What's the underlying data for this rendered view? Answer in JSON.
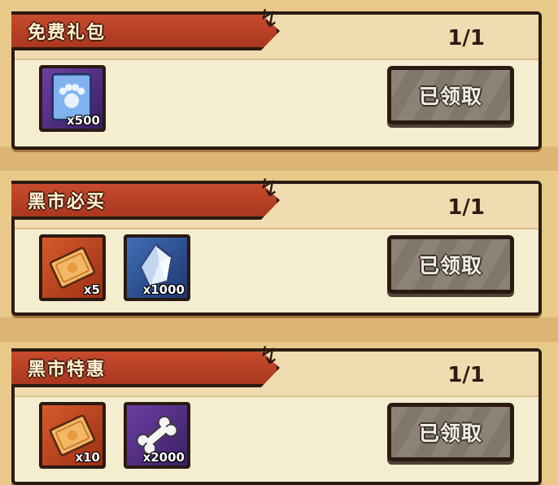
{
  "packs": [
    {
      "title": "免费礼包",
      "count": "1/1",
      "button_label": "已领取",
      "items": [
        {
          "icon": "paw-card-icon",
          "qty": "x500"
        }
      ]
    },
    {
      "title": "黑市必买",
      "count": "1/1",
      "button_label": "已领取",
      "items": [
        {
          "icon": "ticket-scroll-icon",
          "qty": "x5"
        },
        {
          "icon": "crystal-icon",
          "qty": "x1000"
        }
      ]
    },
    {
      "title": "黑市特惠",
      "count": "1/1",
      "button_label": "已领取",
      "items": [
        {
          "icon": "ticket-scroll-icon",
          "qty": "x10"
        },
        {
          "icon": "bone-icon",
          "qty": "x2000"
        }
      ]
    }
  ]
}
